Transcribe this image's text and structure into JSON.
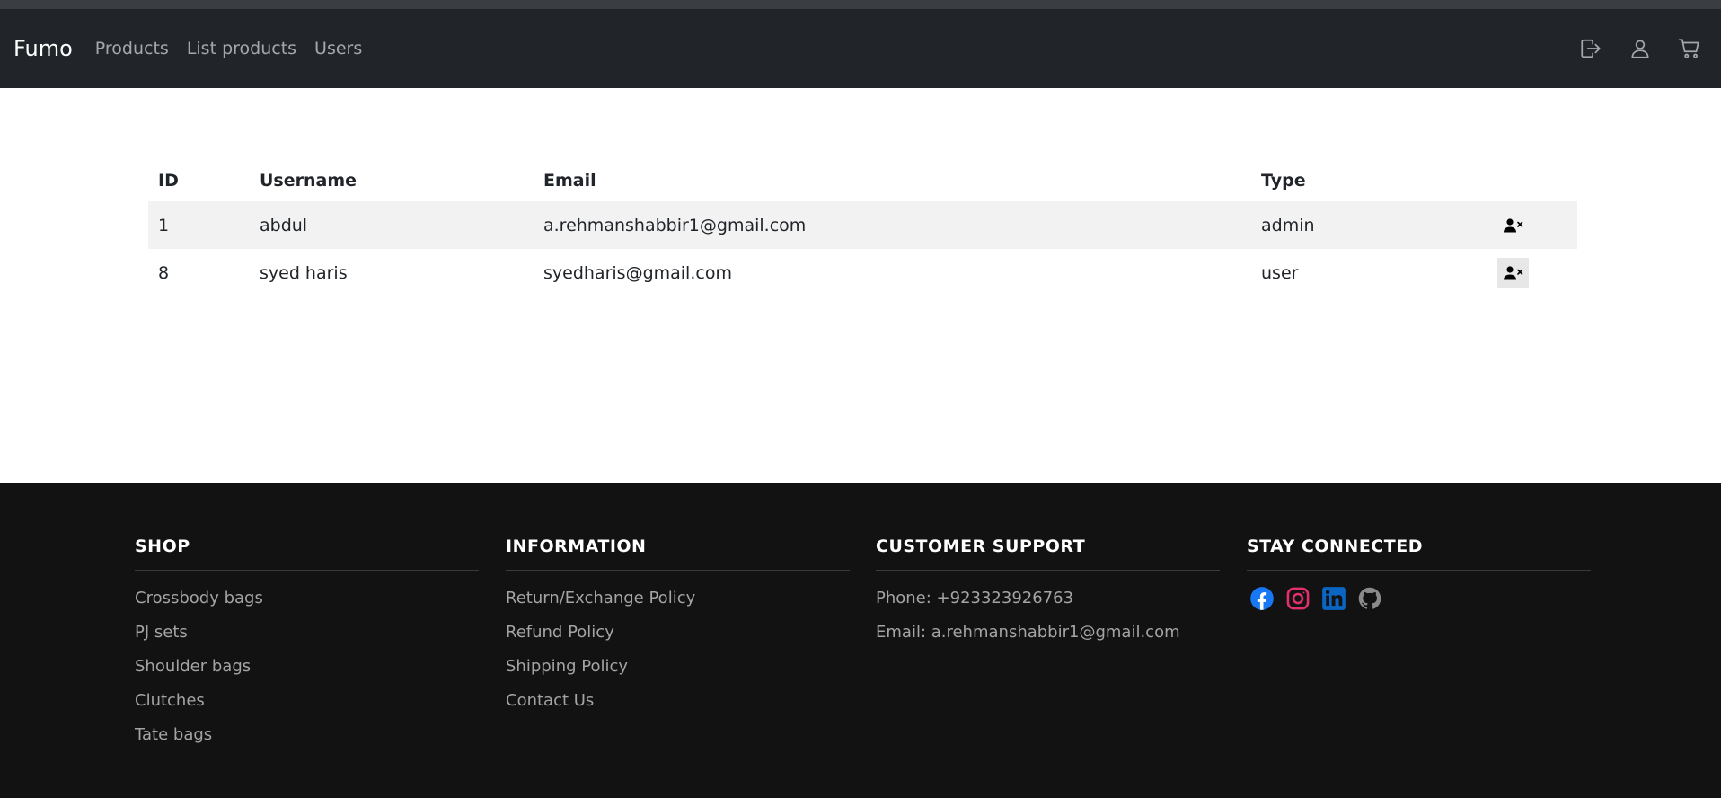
{
  "navbar": {
    "brand": "Fumo",
    "links": [
      "Products",
      "List products",
      "Users"
    ],
    "icons": [
      "logout-icon",
      "user-icon",
      "cart-icon"
    ]
  },
  "users_table": {
    "headers": [
      "ID",
      "Username",
      "Email",
      "Type"
    ],
    "rows": [
      {
        "id": "1",
        "username": "abdul",
        "email": "a.rehmanshabbir1@gmail.com",
        "type": "admin",
        "action_icon": "remove-user-icon"
      },
      {
        "id": "8",
        "username": "syed haris",
        "email": "syedharis@gmail.com",
        "type": "user",
        "action_icon": "remove-user-icon"
      }
    ]
  },
  "footer": {
    "shop": {
      "title": "SHOP",
      "items": [
        "Crossbody bags",
        "PJ sets",
        "Shoulder bags",
        "Clutches",
        "Tate bags"
      ]
    },
    "information": {
      "title": "INFORMATION",
      "items": [
        "Return/Exchange Policy",
        "Refund Policy",
        "Shipping Policy",
        "Contact Us"
      ]
    },
    "support": {
      "title": "CUSTOMER SUPPORT",
      "phone": "Phone: +923323926763",
      "email": "Email: a.rehmanshabbir1@gmail.com"
    },
    "connected": {
      "title": "STAY CONNECTED",
      "icons": [
        "facebook-icon",
        "instagram-icon",
        "linkedin-icon",
        "github-icon"
      ]
    }
  },
  "colors": {
    "navbar_bg": "#212529",
    "footer_bg": "#121212",
    "facebook": "#1877f2",
    "instagram": "#e1306c",
    "linkedin": "#0a66c2",
    "github": "#8a8a8a"
  }
}
